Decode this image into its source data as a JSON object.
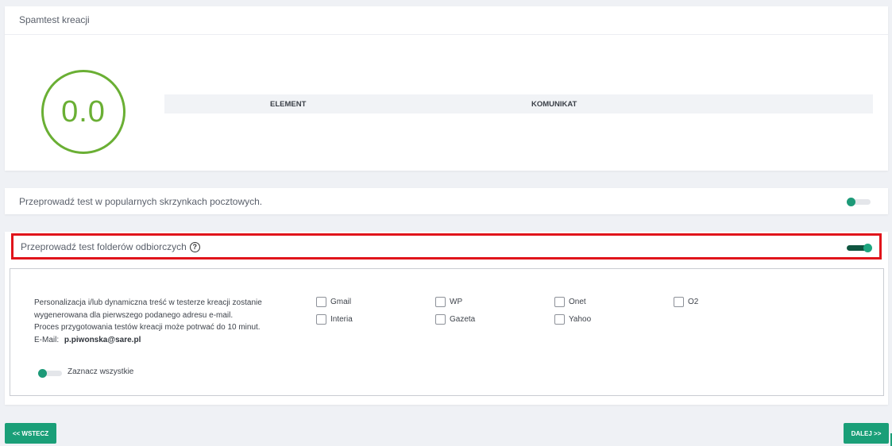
{
  "spamtest": {
    "title": "Spamtest kreacji",
    "score": "0.0",
    "columns": {
      "element": "ELEMENT",
      "message": "KOMUNIKAT"
    },
    "score_color": "#6aaf34"
  },
  "mailbox_test": {
    "label": "Przeprowadź test w popularnych skrzynkach pocztowych.",
    "enabled": false
  },
  "folders_test": {
    "label": "Przeprowadź test folderów odbiorczych",
    "help_icon": "question-circle-icon",
    "enabled": true,
    "info_lines": [
      "Personalizacja i/lub dynamiczna treść w testerze kreacji zostanie",
      "wygenerowana dla pierwszego podanego adresu e-mail.",
      "Proces przygotowania testów kreacji może potrwać do 10 minut."
    ],
    "email_label": "E-Mail:",
    "email_value": "p.piwonska@sare.pl",
    "providers": [
      {
        "label": "Gmail",
        "checked": false
      },
      {
        "label": "WP",
        "checked": false
      },
      {
        "label": "Onet",
        "checked": false
      },
      {
        "label": "O2",
        "checked": false
      },
      {
        "label": "Interia",
        "checked": false
      },
      {
        "label": "Gazeta",
        "checked": false
      },
      {
        "label": "Yahoo",
        "checked": false
      }
    ],
    "select_all_label": "Zaznacz wszystkie",
    "select_all_enabled": false,
    "highlight_color": "#e0141b"
  },
  "nav": {
    "back_label": "<< WSTECZ",
    "next_label": "DALEJ >>",
    "accent": "#1a9f78"
  }
}
